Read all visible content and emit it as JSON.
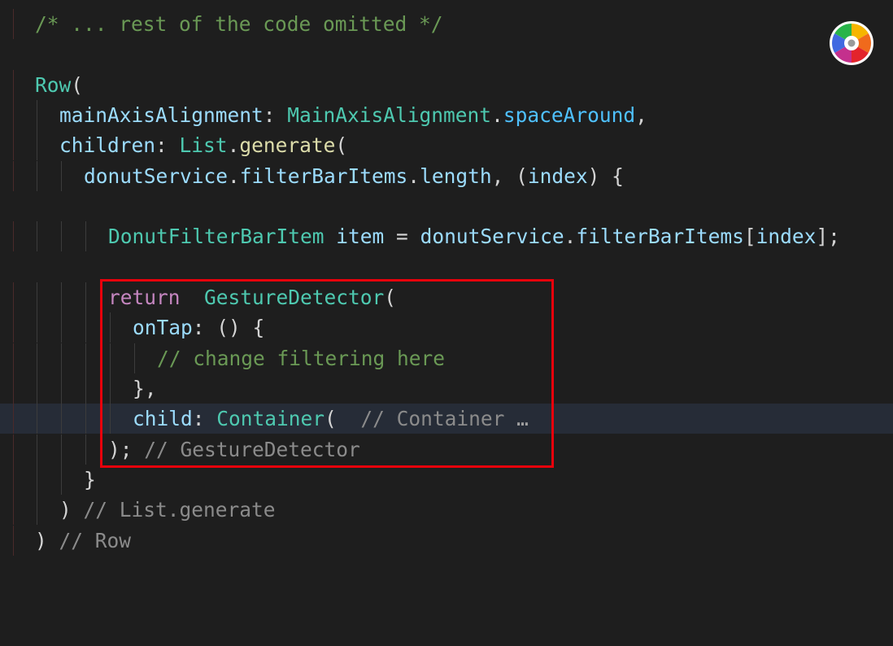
{
  "editor": {
    "lines": {
      "l1": {
        "comment": "/* ... rest of the code omitted */"
      },
      "l3": {
        "class": "Row",
        "open": "("
      },
      "l4": {
        "prop": "mainAxisAlignment",
        "colon": ":",
        "class": "MainAxisAlignment",
        "dot": ".",
        "enum": "spaceAround",
        "comma": ","
      },
      "l5": {
        "prop": "children",
        "colon": ":",
        "class": "List",
        "dot": ".",
        "fn": "generate",
        "open": "("
      },
      "l6": {
        "obj": "donutService",
        "dot1": ".",
        "prop1": "filterBarItems",
        "dot2": ".",
        "prop2": "length",
        "rest": ", (",
        "param": "index",
        "close": ") {"
      },
      "l8": {
        "class": "DonutFilterBarItem",
        "space": " ",
        "var": "item",
        "eq": " = ",
        "obj": "donutService",
        "dot": ".",
        "prop": "filterBarItems",
        "open": "[",
        "idx": "index",
        "close": "];"
      },
      "l10": {
        "keyword": "return",
        "space": "  ",
        "class": "GestureDetector",
        "open": "("
      },
      "l11": {
        "prop": "onTap",
        "rest": ": () {"
      },
      "l12": {
        "comment": "// change filtering here"
      },
      "l13": {
        "text": "},"
      },
      "l14": {
        "prop": "child",
        "colon": ": ",
        "class": "Container",
        "open": "(",
        "hint": "  // Container",
        "ellipsis": " …"
      },
      "l15": {
        "text": ");",
        "hint": " // GestureDetector"
      },
      "l16": {
        "text": "}"
      },
      "l17": {
        "text": ")",
        "hint": " // List.generate"
      },
      "l18": {
        "text": ")",
        "hint": " // Row"
      }
    }
  },
  "colors": {
    "background": "#1e1e1e",
    "current_line": "#262c37",
    "highlight_border": "#e8000b"
  },
  "icons": {
    "logo": "color-wheel-icon"
  }
}
